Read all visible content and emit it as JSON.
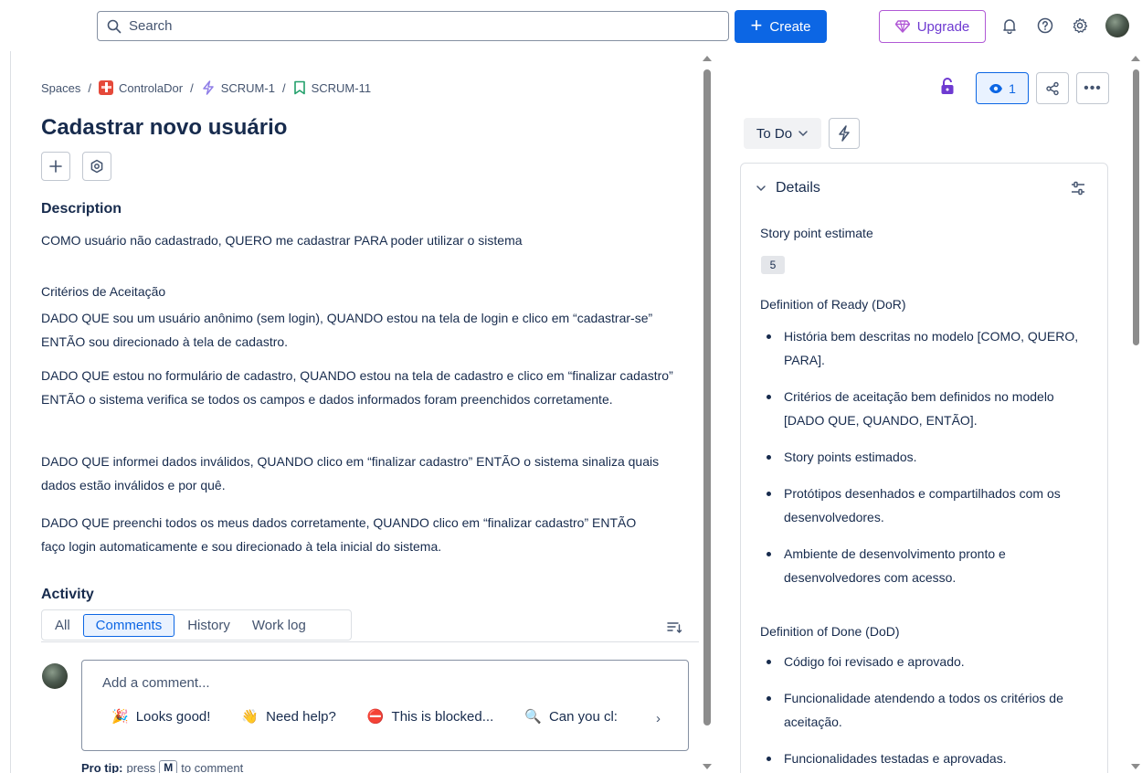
{
  "topbar": {
    "search_placeholder": "Search",
    "create_label": "Create",
    "upgrade_label": "Upgrade",
    "colors": {
      "primary": "#0c66e4",
      "upgrade": "#6e3ad1"
    }
  },
  "breadcrumb": {
    "root": "Spaces",
    "project": "ControlaDor",
    "epic": "SCRUM-1",
    "issue": "SCRUM-11"
  },
  "issue": {
    "title": "Cadastrar novo usuário",
    "description_heading": "Description",
    "description": "COMO usuário não cadastrado, QUERO me cadastrar PARA poder utilizar o sistema",
    "criteria_heading": "Critérios de Aceitação",
    "criteria": [
      "DADO QUE sou um usuário anônimo (sem login), QUANDO estou na tela de login e clico em “cadastrar-se” ENTÃO sou direcionado à tela de cadastro.",
      "DADO QUE estou no formulário de cadastro, QUANDO estou na tela de cadastro e clico em “finalizar cadastro” ENTÃO o sistema verifica se todos os campos e dados informados foram preenchidos corretamente.",
      "DADO QUE informei dados inválidos, QUANDO clico em “finalizar cadastro” ENTÃO o sistema sinaliza quais dados estão inválidos e por quê.",
      "DADO QUE preenchi todos os meus dados corretamente, QUANDO clico em “finalizar cadastro” ENTÃO faço login automaticamente e sou direcionado à tela inicial do sistema."
    ]
  },
  "activity": {
    "heading": "Activity",
    "tabs": [
      "All",
      "Comments",
      "History",
      "Work log"
    ],
    "active_tab": "Comments",
    "comment_placeholder": "Add a comment...",
    "chips": [
      {
        "emoji": "🎉",
        "label": "Looks good!"
      },
      {
        "emoji": "👋",
        "label": "Need help?"
      },
      {
        "emoji": "⛔",
        "label": "This is blocked..."
      },
      {
        "emoji": "🔍",
        "label": "Can you cl:"
      }
    ],
    "pro_tip_label": "Pro tip:",
    "pro_tip_pre": "press",
    "pro_tip_key": "M",
    "pro_tip_post": "to comment"
  },
  "sidebar": {
    "watchers_count": "1",
    "status": "To Do",
    "details_heading": "Details",
    "story_point_label": "Story point estimate",
    "story_points": "5",
    "dor_label": "Definition of Ready (DoR)",
    "dor_items": [
      "História bem descritas no modelo [COMO, QUERO, PARA].",
      "Critérios de aceitação bem definidos no modelo [DADO QUE, QUANDO, ENTÃO].",
      "Story points estimados.",
      "Protótipos desenhados e compartilhados com os desenvolvedores.",
      "Ambiente de desenvolvimento pronto e desenvolvedores com acesso."
    ],
    "dod_label": "Definition of Done (DoD)",
    "dod_items": [
      "Código foi revisado e aprovado.",
      "Funcionalidade atendendo a todos os critérios de aceitação.",
      "Funcionalidades testadas e aprovadas."
    ]
  }
}
